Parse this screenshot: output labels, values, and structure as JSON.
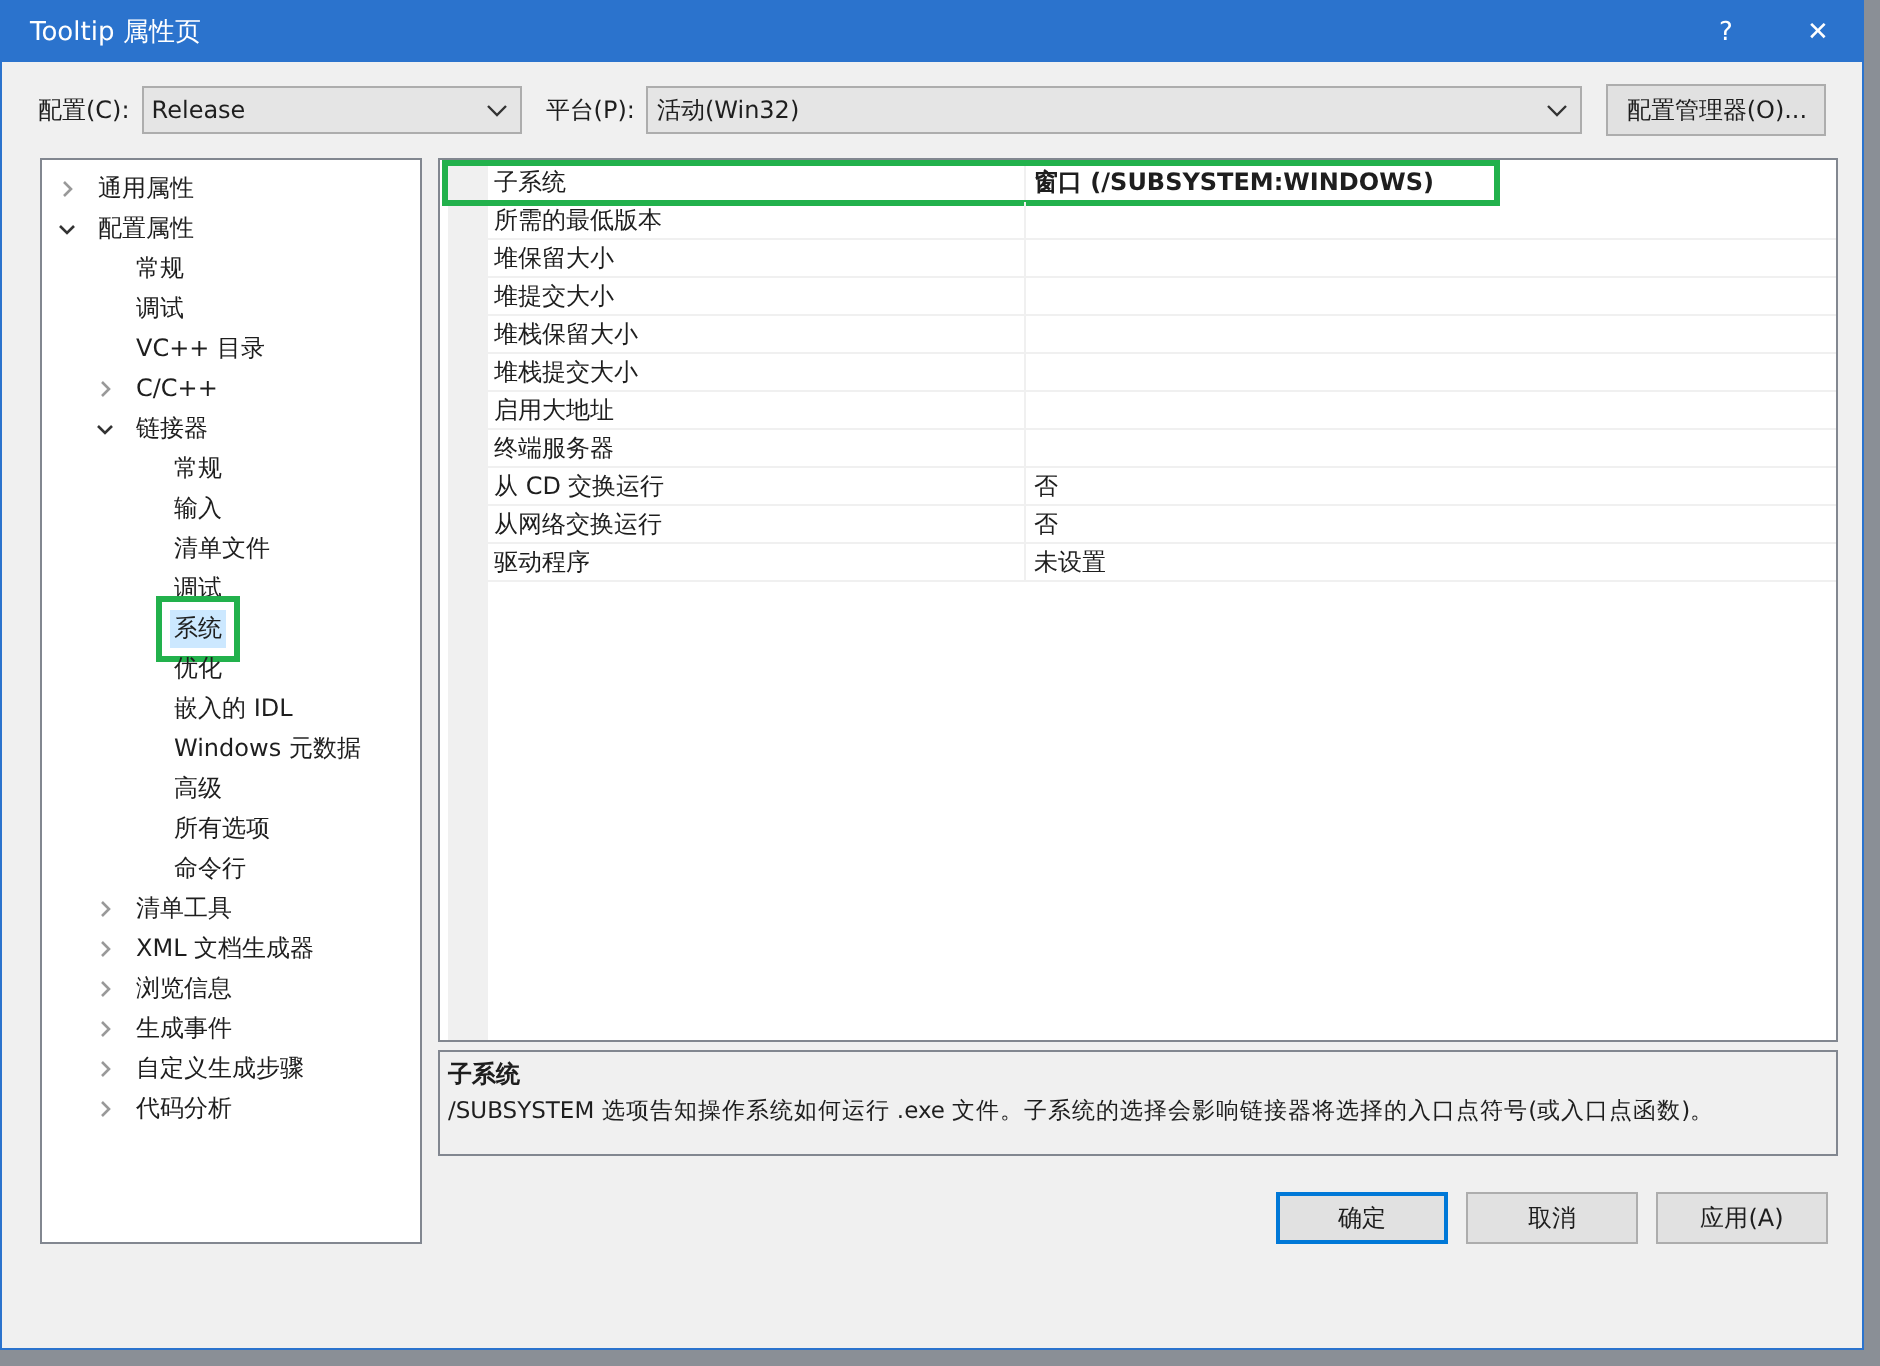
{
  "window": {
    "title": "Tooltip 属性页",
    "help": "?",
    "close": "✕"
  },
  "toolbar": {
    "config_label": "配置(C):",
    "config_value": "Release",
    "platform_label": "平台(P):",
    "platform_value": "活动(Win32)",
    "manager_button": "配置管理器(O)..."
  },
  "tree": [
    {
      "label": "通用属性",
      "expanded": false,
      "selected": false,
      "outlined": false
    },
    {
      "label": "配置属性",
      "expanded": true,
      "selected": false,
      "outlined": false,
      "children": [
        {
          "label": "常规",
          "selected": false,
          "outlined": false
        },
        {
          "label": "调试",
          "selected": false,
          "outlined": false
        },
        {
          "label": "VC++ 目录",
          "selected": false,
          "outlined": false
        },
        {
          "label": "C/C++",
          "expanded": false,
          "selected": false,
          "outlined": false
        },
        {
          "label": "链接器",
          "expanded": true,
          "selected": false,
          "outlined": false,
          "children": [
            {
              "label": "常规",
              "selected": false,
              "outlined": false
            },
            {
              "label": "输入",
              "selected": false,
              "outlined": false
            },
            {
              "label": "清单文件",
              "selected": false,
              "outlined": false
            },
            {
              "label": "调试",
              "selected": false,
              "outlined": false
            },
            {
              "label": "系统",
              "selected": true,
              "outlined": true
            },
            {
              "label": "优化",
              "selected": false,
              "outlined": false
            },
            {
              "label": "嵌入的 IDL",
              "selected": false,
              "outlined": false
            },
            {
              "label": "Windows 元数据",
              "selected": false,
              "outlined": false
            },
            {
              "label": "高级",
              "selected": false,
              "outlined": false
            },
            {
              "label": "所有选项",
              "selected": false,
              "outlined": false
            },
            {
              "label": "命令行",
              "selected": false,
              "outlined": false
            }
          ]
        },
        {
          "label": "清单工具",
          "expanded": false,
          "selected": false,
          "outlined": false
        },
        {
          "label": "XML 文档生成器",
          "expanded": false,
          "selected": false,
          "outlined": false
        },
        {
          "label": "浏览信息",
          "expanded": false,
          "selected": false,
          "outlined": false
        },
        {
          "label": "生成事件",
          "expanded": false,
          "selected": false,
          "outlined": false
        },
        {
          "label": "自定义生成步骤",
          "expanded": false,
          "selected": false,
          "outlined": false
        },
        {
          "label": "代码分析",
          "expanded": false,
          "selected": false,
          "outlined": false
        }
      ]
    }
  ],
  "properties": [
    {
      "name": "子系统",
      "value": "窗口 (/SUBSYSTEM:WINDOWS)",
      "bold": true,
      "outlined": true
    },
    {
      "name": "所需的最低版本",
      "bold": false,
      "outlined": false
    },
    {
      "name": "堆保留大小",
      "bold": false,
      "outlined": false
    },
    {
      "name": "堆提交大小",
      "bold": false,
      "outlined": false
    },
    {
      "name": "堆栈保留大小",
      "bold": false,
      "outlined": false
    },
    {
      "name": "堆栈提交大小",
      "bold": false,
      "outlined": false
    },
    {
      "name": "启用大地址",
      "bold": false,
      "outlined": false
    },
    {
      "name": "终端服务器",
      "bold": false,
      "outlined": false
    },
    {
      "name": "从 CD 交换运行",
      "value": "否",
      "bold": false,
      "outlined": false
    },
    {
      "name": "从网络交换运行",
      "value": "否",
      "bold": false,
      "outlined": false
    },
    {
      "name": "驱动程序",
      "value": "未设置",
      "bold": false,
      "outlined": false
    }
  ],
  "description": {
    "title": "子系统",
    "text": "/SUBSYSTEM 选项告知操作系统如何运行 .exe 文件。子系统的选择会影响链接器将选择的入口点符号(或入口点函数)。"
  },
  "buttons": [
    {
      "label": "确定",
      "default": true
    },
    {
      "label": "取消",
      "default": false
    },
    {
      "label": "应用(A)",
      "default": false
    }
  ]
}
